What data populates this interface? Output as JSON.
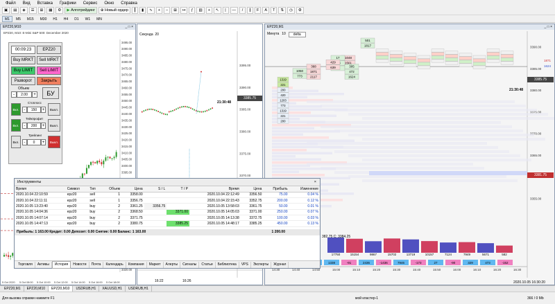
{
  "menu": [
    "Файл",
    "Вид",
    "Вставка",
    "Графики",
    "Сервис",
    "Окно",
    "Справка"
  ],
  "toolbar": {
    "algo": "Алготрейдинг",
    "new_order": "Новый ордер"
  },
  "timeframes": [
    "M1",
    "M5",
    "M15",
    "M30",
    "H1",
    "H4",
    "D1",
    "W1",
    "MN"
  ],
  "win1": {
    "title": "EPZ20,M10",
    "subtitle": "EPZ20, M10: E-Mini S&P 500: December 2020",
    "time": "00:09:23",
    "symbol": "EPZ20",
    "buy_mrkt": "Buy MRKT",
    "sell_mrkt": "Sell MRKT",
    "buy_limit": "Buy LIMIT",
    "sell_limit": "Sell LIMIT",
    "reverse": "Разворот",
    "close": "Закрыть",
    "volume_label": "Объем",
    "volume": "2.00",
    "by": "БУ",
    "stoploss_label": "Стоплосс",
    "stoploss": "150",
    "takeprofit_label": "Тейкпрофит",
    "takeprofit": "200",
    "trailing_label": "Трейлинг",
    "trailing": "0",
    "on": "Вкл.",
    "off": "Выкл.",
    "minus": "-",
    "plus": "+",
    "prices": [
      "3495.00",
      "3490.00",
      "3485.00",
      "3480.00",
      "3475.00",
      "3470.00",
      "3465.00",
      "3460.00",
      "3455.00",
      "3450.00",
      "3445.00",
      "3440.00",
      "3435.00",
      "3430.00",
      "3425.00",
      "3420.00",
      "3415.00",
      "3410.00",
      "3405.00",
      "3400.00",
      "3395.00",
      "3390.00",
      "3385.00",
      "3380.00",
      "3375.00",
      "3370.00",
      "3365.00",
      "3360.00",
      "3355.00",
      "3350.00",
      "3345.00",
      "3340.00",
      "3335.00",
      "3330.00",
      "3325.00",
      "3320.00"
    ],
    "dates": [
      "5 Oct 2020",
      "5 Oct 08:00",
      "5 Oct 10:00",
      "5 Oct 12:00",
      "5 Oct 14:00",
      "5 Oct 16:00",
      "5 Oct 18:00"
    ]
  },
  "win2": {
    "label": "Секунда",
    "value": "20",
    "prices": [
      "3395.00",
      "3390.00",
      "3385.00",
      "3380.00",
      "3375.00",
      "3370.00"
    ],
    "current": "3385.75",
    "time": "21:30:48",
    "bottom": [
      "16:22",
      "16:26"
    ]
  },
  "win3": {
    "title": "EPZ20,M1",
    "label": "Минута",
    "value": "10",
    "mode": "delta",
    "prices": [
      "3390.00",
      "3385.00",
      "3380.00",
      "3375.00",
      "3370.00",
      "3365.00",
      "3360.00",
      "3355.00"
    ],
    "current": "3385.75",
    "time": "21:30:48",
    "mark": "3381.75",
    "side_vals": [
      "1871",
      "1624"
    ],
    "cluster_text": "382.75  C: 3384.25",
    "times": [
      "14:30",
      "14:40",
      "14:50",
      "15:00",
      "15:10",
      "15:20",
      "15:30",
      "15:40",
      "15:50",
      "16:00",
      "16:10",
      "16:20",
      "16:30"
    ],
    "datetime": "2020.10.05 16:30:20",
    "vol_row": [
      "17750",
      "15154",
      "9867",
      "15702",
      "13719",
      "10157",
      "7124",
      "7949",
      "5671",
      "582"
    ],
    "delta_row": [
      "341",
      "537",
      "2935",
      "1338",
      "-91",
      "2436",
      "-1436",
      "7946",
      "-173",
      "27",
      "-90",
      "329",
      "473",
      "-152"
    ],
    "top_cells": [
      [
        "501",
        "1817"
      ],
      [
        "1048",
        "1561"
      ],
      [
        "17",
        "203",
        "3"
      ],
      [
        "368",
        "1871",
        "2117"
      ],
      [
        "305",
        "472",
        "1624"
      ],
      [
        "429",
        "639"
      ],
      [
        "1050",
        "773"
      ]
    ],
    "left_cells": [
      "1319",
      "221",
      "200",
      "420",
      "1203",
      "773",
      "1319",
      "221",
      "200"
    ]
  },
  "instruments": {
    "title": "Инструменты",
    "headers": [
      "Время",
      "Символ",
      "Тип",
      "Объем",
      "Цена",
      "S / L",
      "T / P",
      "Время",
      "Цена",
      "Прибыль",
      "Изменение"
    ],
    "rows": [
      [
        "2020.10.04 22:10:59",
        "epz20",
        "sell",
        "1",
        "3358.00",
        "",
        "",
        "2020.10.04 22:12:49",
        "3356.50",
        "75.00",
        "0.04 %"
      ],
      [
        "2020.10.04 22:11:11",
        "epz20",
        "sell",
        "1",
        "3356.75",
        "",
        "",
        "2020.10.04 22:15:43",
        "3352.75",
        "200.00",
        "0.12 %"
      ],
      [
        "2020.10.05 13:23:40",
        "epz20",
        "buy",
        "2",
        "3361.25",
        "3356.75",
        "",
        "2020.10.05 13:58:03",
        "3361.75",
        "50.00",
        "0.01 %"
      ],
      [
        "2020.10.05 14:04:36",
        "epz20",
        "buy",
        "2",
        "3368.50",
        "",
        "3371.00",
        "2020.10.05 14:05:03",
        "3371.00",
        "250.00",
        "0.07 %"
      ],
      [
        "2020.10.05 14:07:14",
        "epz20",
        "buy",
        "2",
        "3371.75",
        "",
        "",
        "2020.10.05 14:13:38",
        "3372.75",
        "100.00",
        "0.03 %"
      ],
      [
        "2020.10.05 14:47:13",
        "epz20",
        "buy",
        "2",
        "3380.75",
        "",
        "3385.25",
        "2020.10.05 14:48:17",
        "3385.25",
        "450.00",
        "0.13 %"
      ]
    ],
    "summary": "Прибыль: 1 163.00  Кредит: 0.00  Депозит: 0.00  Снятие: 0.00  Баланс: 1 163.00",
    "summary_total": "1 200.00",
    "tabs": [
      "Торговля",
      "Активы",
      "История",
      "Новости",
      "Почта",
      "Календарь",
      "Компания",
      "Маркет",
      "Алерты",
      "Сигналы",
      "Статьи",
      "Библиотека",
      "VPS",
      "Эксперты",
      "Журнал"
    ]
  },
  "chart_tabs": [
    "EPZ20,M1",
    "EPZ20,M10",
    "EPZ20,M10",
    "USDRUB,H1",
    "XAUUSD,H1",
    "USDRUB,H1"
  ],
  "status": {
    "left": "Для вызова справки нажмите F1",
    "middle": "мой кластер-1",
    "right": "366 / 0 Mb"
  },
  "colors": {
    "green": "#2e9a2e",
    "red": "#d03030",
    "bid": "#0000ff"
  }
}
